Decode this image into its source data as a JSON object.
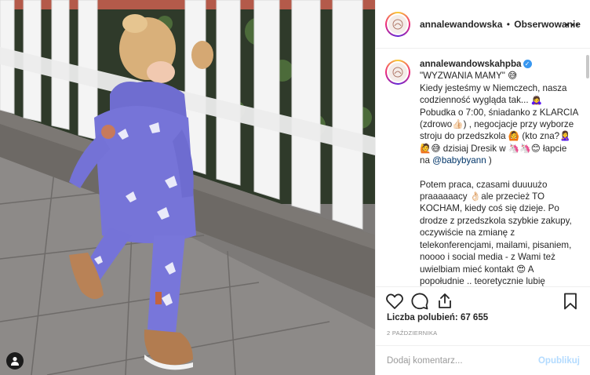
{
  "header": {
    "username": "annalewandowska",
    "separator": "•",
    "follow_label": "Obserwowanie"
  },
  "caption": {
    "username": "annalewandowskahpba",
    "title": "\"WYZWANIA MAMY\" 😅",
    "para1": "Kiedy jesteśmy w Niemczech, nasza codzienność wygląda tak... 🙇‍♀️ Pobudka o 7:00, śniadanko z KLARCIA (zdrowo👍🏻) , negocjacje przy wyborze stroju do przedszkola 🙆 (kto zna?🙎‍♀️🙋😅 dzisiaj Dresik w 🦄🦄😊 łapcie na",
    "mention": "@babybyann",
    "para1_end": ")",
    "para2": "Potem praca, czasami duuuużo praaaaaacy 👌🏻ale przecież TO KOCHAM, kiedy coś się dzieje. Po drodze z przedszkola szybkie zakupy, oczywiście na zmianę z telekonferencjami, mailami, pisaniem, noooo i social media - z Wami też uwielbiam mieć kontakt 😍 A popołudnie .. teoretycznie lubię planować, ale często mne tak szybko"
  },
  "stats": {
    "likes_label": "Liczba polubień:",
    "likes_count": "67 655",
    "date": "2 PAŹDZIERNIKA"
  },
  "comment": {
    "placeholder": "Dodaj komentarz...",
    "publish_label": "Opublikuj"
  },
  "icons": {
    "like": "heart-icon",
    "comment": "comment-icon",
    "share": "share-icon",
    "save": "bookmark-icon",
    "more": "more-icon",
    "user_tag": "user-icon"
  },
  "colors": {
    "link": "#003569",
    "verified": "#3897f0",
    "publish_disabled": "#b3dbff",
    "muted": "#8e8e8e"
  }
}
